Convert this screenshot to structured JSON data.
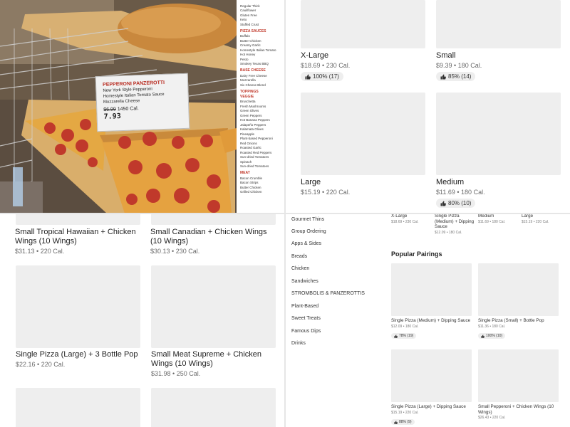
{
  "photo": {
    "label": {
      "title": "PEPPERONI PANZEROTTI",
      "lines": [
        "New York Style Pepperoni",
        "Homestyle Italian Tomato Sauce",
        "Mozzarella Cheese"
      ],
      "old_price": "$6.99",
      "calories": "1450 Cal.",
      "new_price": "7.93"
    },
    "menu_board": {
      "crusts": [
        "Regular Thick",
        "Cauliflower",
        "Gluten Free",
        "Keto",
        "Stuffed Crust"
      ],
      "sauces_heading": "PIZZA SAUCES",
      "sauces": [
        "Buffalo",
        "Butter Chicken",
        "Creamy Garlic",
        "Homestyle Italian Tomato",
        "Hot Honey",
        "Pesto",
        "Smokey Texas BBQ"
      ],
      "base_cheese_heading": "BASE CHEESE",
      "base_cheese": [
        "Dairy Free Cheese",
        "Mozzarella",
        "Six Cheese Blend"
      ],
      "toppings_heading": "TOPPINGS",
      "veggie_heading": "VEGGIE",
      "veggies": [
        "Bruschetta",
        "Fresh Mushrooms",
        "Green Olives",
        "Green Peppers",
        "Hot Banana Peppers",
        "Jalapeño Peppers",
        "Kalamata Olives",
        "Pineapple",
        "Plant-based Pepperoni",
        "Red Onions",
        "Roasted Garlic",
        "Roasted Red Peppers",
        "Sun-dried Tomatoes",
        "Spinach",
        "Sun-dried Tomatoes"
      ],
      "meat_heading": "MEAT",
      "meats": [
        "Bacon Crumble",
        "Bacon Strips",
        "Butter Chicken",
        "Grilled Chicken"
      ]
    }
  },
  "top_right": {
    "cards": [
      {
        "title": "X-Large",
        "price": "$18.69",
        "cal": "230 Cal.",
        "rating": "100% (17)"
      },
      {
        "title": "Small",
        "price": "$9.39",
        "cal": "180 Cal.",
        "rating": "85% (14)"
      },
      {
        "title": "Large",
        "price": "$15.19",
        "cal": "220 Cal.",
        "rating": ""
      },
      {
        "title": "Medium",
        "price": "$11.69",
        "cal": "180 Cal.",
        "rating": "80% (10)"
      }
    ]
  },
  "bottom_left": {
    "cards": [
      {
        "title": "Small Tropical Hawaiian + Chicken Wings (10 Wings)",
        "price": "$31.13",
        "cal": "220 Cal."
      },
      {
        "title": "Small Canadian + Chicken Wings (10 Wings)",
        "price": "$30.13",
        "cal": "230 Cal."
      },
      {
        "title": "Single Pizza (Large) + 3 Bottle Pop",
        "price": "$22.16",
        "cal": "220 Cal."
      },
      {
        "title": "Small Meat Supreme + Chicken Wings (10 Wings)",
        "price": "$31.98",
        "cal": "250 Cal."
      }
    ]
  },
  "bottom_right": {
    "sidebar": [
      "Gourmet Thins",
      "Group Ordering",
      "Apps & Sides",
      "Breads",
      "Chicken",
      "Sandwiches",
      "STROMBOLIS & PANZEROTTIS",
      "Plant-Based",
      "Sweet Treats",
      "Famous Dips",
      "Drinks"
    ],
    "top_row": [
      {
        "title": "X-Large",
        "price": "$18.69",
        "cal": "230 Cal."
      },
      {
        "title": "Single Pizza (Medium) + Dipping Sauce",
        "price": "$12.09",
        "cal": "180 Cal."
      },
      {
        "title": "Medium",
        "price": "$11.69",
        "cal": "180 Cal."
      },
      {
        "title": "Large",
        "price": "$15.19",
        "cal": "220 Cal."
      }
    ],
    "popular_heading": "Popular Pairings",
    "pairings": [
      {
        "title": "Single Pizza (Medium) + Dipping Sauce",
        "price": "$12.09",
        "cal": "180 Cal.",
        "rating": "78% (19)"
      },
      {
        "title": "Single Pizza (Small) + Bottle Pop",
        "price": "$11.36",
        "cal": "180 Cal.",
        "rating": "100% (10)"
      },
      {
        "title": "Single Pizza (Large) + Dipping Sauce",
        "price": "$15.19",
        "cal": "220 Cal.",
        "rating": "88% (9)"
      },
      {
        "title": "Small Pepperoni + Chicken Wings (10 Wings)",
        "price": "$26.43",
        "cal": "220 Cal.",
        "rating": ""
      }
    ]
  },
  "separator": "•",
  "colors": {
    "brand_red": "#b82a1f",
    "placeholder": "#eeeeee",
    "muted_text": "#6b6b6b"
  },
  "icons": {
    "rating": "thumbs-up-icon"
  }
}
